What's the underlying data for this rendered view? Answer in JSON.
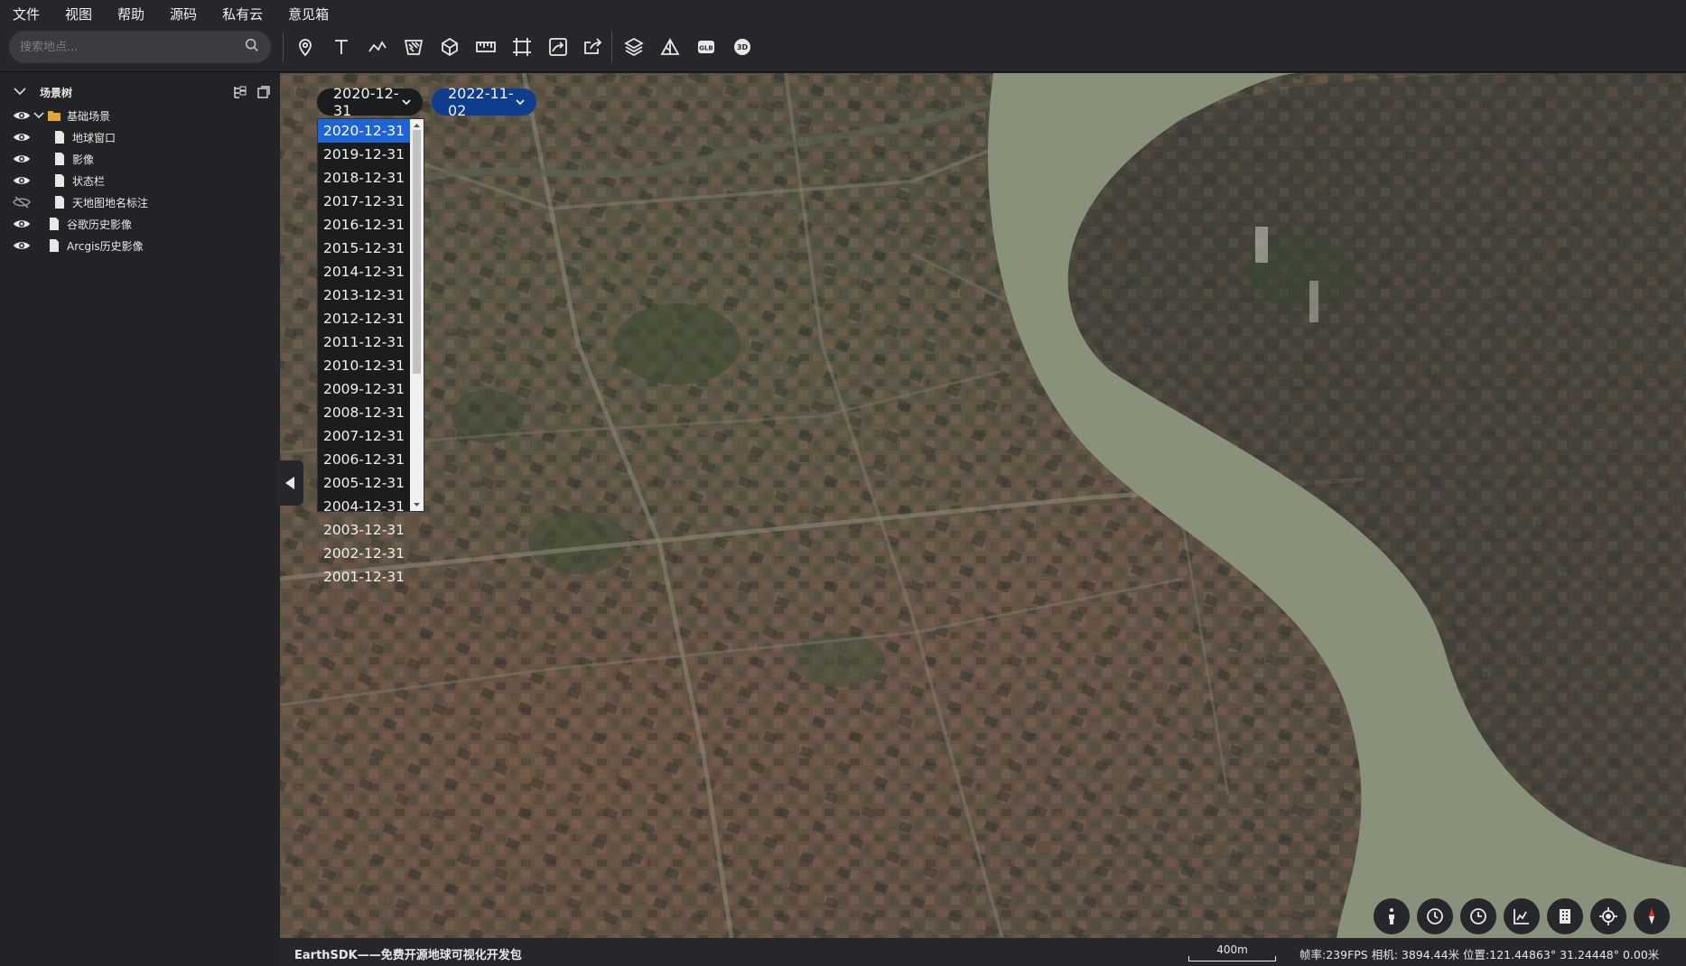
{
  "menu": [
    "文件",
    "视图",
    "帮助",
    "源码",
    "私有云",
    "意见箱"
  ],
  "search": {
    "placeholder": "搜索地点..."
  },
  "toolbar": {
    "tools": [
      "location-pin-icon",
      "text-icon",
      "polyline-icon",
      "polygon-hatch-icon",
      "cube-outline-icon",
      "ruler-icon",
      "frame-icon",
      "path-arrow-icon",
      "share-icon",
      "layers-icon",
      "mountain-icon",
      "glb-icon",
      "3d-icon"
    ],
    "glb_label": "GLB",
    "three_d_label": "3D"
  },
  "scene_tree": {
    "title": "场景树",
    "items": [
      {
        "label": "基础场景",
        "visible": true,
        "type": "folder"
      },
      {
        "label": "地球窗口",
        "visible": true,
        "type": "file"
      },
      {
        "label": "影像",
        "visible": true,
        "type": "file"
      },
      {
        "label": "状态栏",
        "visible": true,
        "type": "file"
      },
      {
        "label": "天地图地名标注",
        "visible": false,
        "type": "file"
      },
      {
        "label": "谷歌历史影像",
        "visible": true,
        "type": "file"
      },
      {
        "label": "Arcgis历史影像",
        "visible": true,
        "type": "file"
      }
    ]
  },
  "date_compare": {
    "left": "2020-12-31",
    "right": "2022-11-02",
    "options": [
      "2020-12-31",
      "2019-12-31",
      "2018-12-31",
      "2017-12-31",
      "2016-12-31",
      "2015-12-31",
      "2014-12-31",
      "2013-12-31",
      "2012-12-31",
      "2011-12-31",
      "2010-12-31",
      "2009-12-31",
      "2008-12-31",
      "2007-12-31",
      "2006-12-31",
      "2005-12-31",
      "2004-12-31",
      "2003-12-31",
      "2002-12-31",
      "2001-12-31"
    ],
    "selected": "2020-12-31"
  },
  "nav_tools": [
    "pedestrian-icon",
    "clock-icon",
    "history-clock-icon",
    "terrain-chart-icon",
    "building-icon",
    "locate-icon",
    "compass-icon"
  ],
  "status": {
    "brand": "EarthSDK——免费开源地球可视化开发包",
    "scale": "400m",
    "stats": "帧率:239FPS 相机: 3894.44米 位置:121.44863° 31.24448° 0.00米"
  },
  "colors": {
    "accent": "#1e64d4",
    "date_b_bg": "#0d3d8c",
    "river": "#8a917a"
  }
}
